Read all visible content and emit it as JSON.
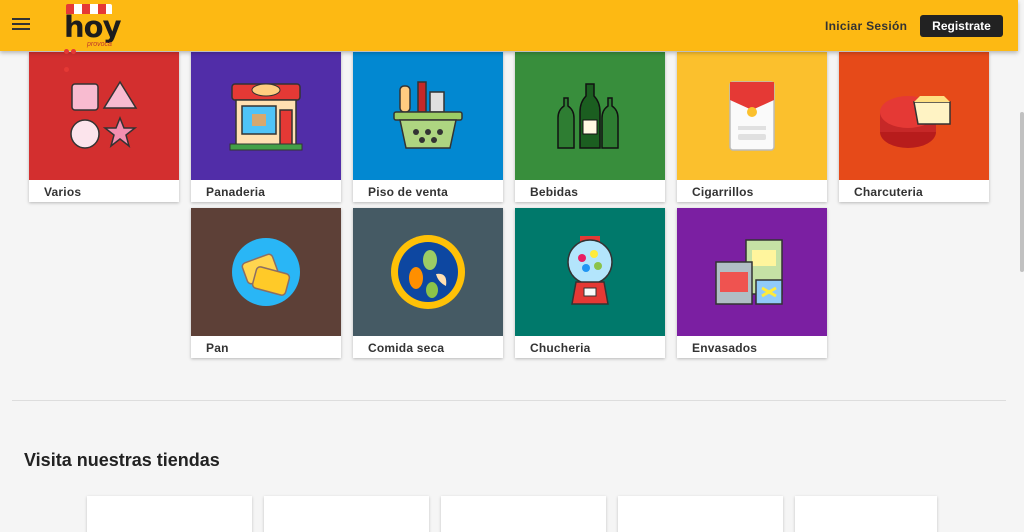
{
  "header": {
    "logo_text": "hoy",
    "logo_subtext": "provoca",
    "login_label": "Iniciar Sesión",
    "register_label": "Registrate"
  },
  "categories": [
    {
      "label": "Varios",
      "color": "#d32f2f",
      "icon": "shapes-icon"
    },
    {
      "label": "Panaderia",
      "color": "#512da8",
      "icon": "bakery-shop-icon"
    },
    {
      "label": "Piso de venta",
      "color": "#0288d1",
      "icon": "grocery-basket-icon"
    },
    {
      "label": "Bebidas",
      "color": "#388e3c",
      "icon": "bottles-icon"
    },
    {
      "label": "Cigarrillos",
      "color": "#fbc02d",
      "icon": "cigarette-pack-icon"
    },
    {
      "label": "Charcuteria",
      "color": "#e64a19",
      "icon": "cheese-icon"
    },
    {
      "label": "Pan",
      "color": "#5d4037",
      "icon": "bread-slices-icon"
    },
    {
      "label": "Comida seca",
      "color": "#455a64",
      "icon": "dry-food-plate-icon"
    },
    {
      "label": "Chucheria",
      "color": "#00796b",
      "icon": "gumball-machine-icon"
    },
    {
      "label": "Envasados",
      "color": "#7b1fa2",
      "icon": "packaged-food-icon"
    }
  ],
  "stores_section": {
    "title": "Visita nuestras tiendas"
  }
}
